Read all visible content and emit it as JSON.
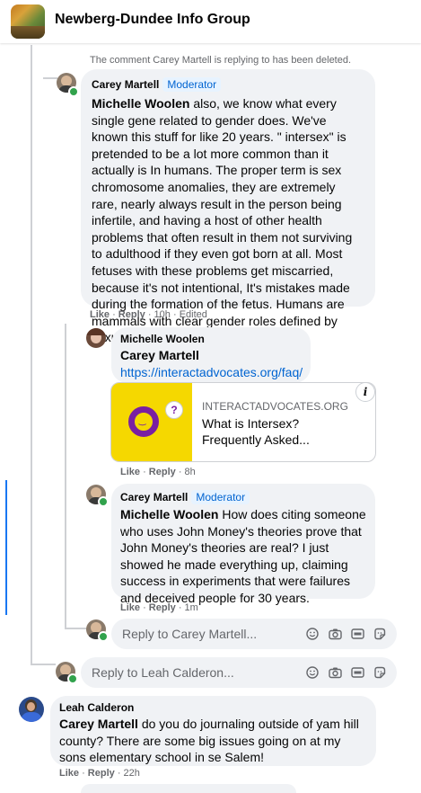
{
  "header": {
    "group_name": "Newberg-Dundee Info Group"
  },
  "deleted_notice": "The comment Carey Martell is replying to has been deleted.",
  "comment1": {
    "author": "Carey Martell",
    "badge": "Moderator",
    "mention": "Michelle Woolen",
    "text": " also, we know what every single gene related to gender does. We've known this stuff for like 20 years. \" intersex\" is pretended to be a lot more common than it actually is In humans. The proper term is sex chromosome anomalies, they are extremely rare, nearly always result in the person being infertile, and having a host of other health problems that often result in them not surviving to adulthood if they even got born at all. Most fetuses with these problems get miscarried, because it's not intentional, It's mistakes made during the formation of the fetus. Humans are mammals with clear gender roles defined by sexual dimorphism.",
    "like": "Like",
    "reply": "Reply",
    "time": "10h",
    "edited": "Edited"
  },
  "comment2": {
    "author": "Michelle Woolen",
    "mention": "Carey Martell",
    "link": "https://interactadvocates.org/faq/",
    "preview_domain": "INTERACTADVOCATES.ORG",
    "preview_title_line1": "What is Intersex?",
    "preview_title_line2": "Frequently Asked...",
    "info_icon": "i",
    "like": "Like",
    "reply": "Reply",
    "time": "8h"
  },
  "comment3": {
    "author": "Carey Martell",
    "badge": "Moderator",
    "mention": "Michelle Woolen",
    "text": " How does citing someone who uses John Money's theories prove that John Money's theories are real? I just showed he made everything up, claiming success in experiments that were failures and deceived people for 30 years.",
    "like": "Like",
    "reply": "Reply",
    "time": "1m"
  },
  "reply_boxes": {
    "reply_carey": "Reply to Carey Martell...",
    "reply_leah": "Reply to Leah Calderon..."
  },
  "comment4": {
    "author": "Leah Calderon",
    "mention": "Carey Martell",
    "text": " do you do journaling outside of yam hill county? There are some big issues going on at my sons elementary school in se Salem!",
    "like": "Like",
    "reply": "Reply",
    "time": "22h"
  },
  "icons": [
    "emoji-icon",
    "camera-icon",
    "gif-icon",
    "sticker-icon"
  ],
  "colors": {
    "accent": "#0064d1",
    "bubble": "#f0f2f5",
    "online": "#31a24c",
    "link_preview_bg": "#f5d800"
  }
}
